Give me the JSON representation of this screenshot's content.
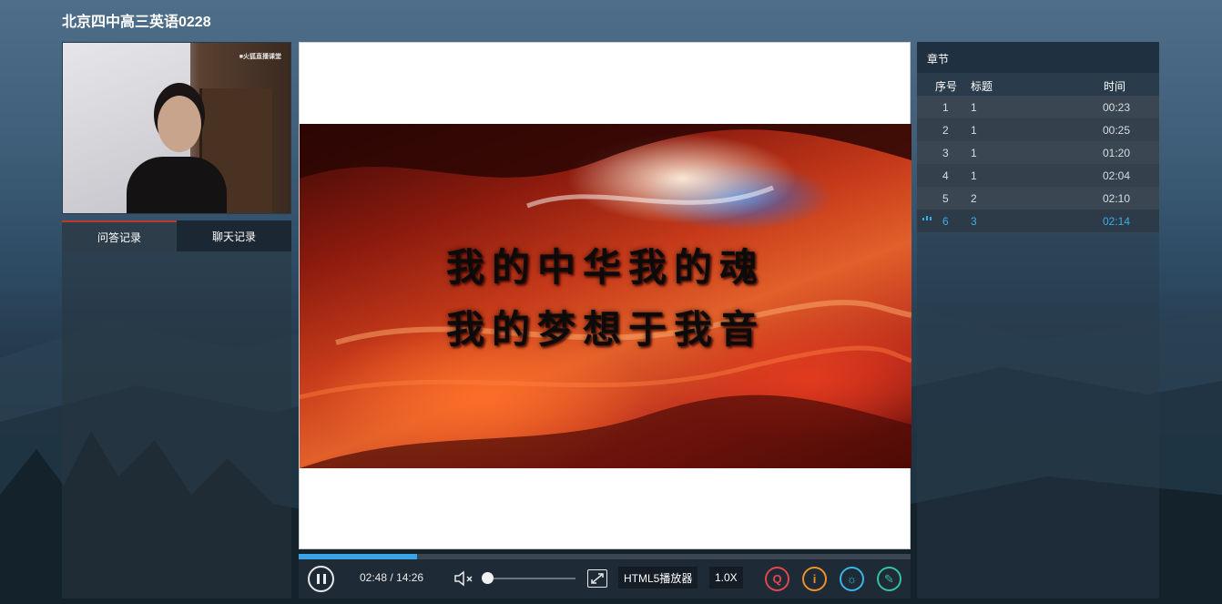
{
  "page": {
    "title": "北京四中高三英语0228"
  },
  "camera": {
    "watermark": "■火狐直播课堂"
  },
  "left_tabs": [
    {
      "label": "问答记录",
      "active": true
    },
    {
      "label": "聊天记录",
      "active": false
    }
  ],
  "slide": {
    "line1": "我的中华我的魂",
    "line2": "我的梦想于我音"
  },
  "player": {
    "current_time": "02:48",
    "separator": "/",
    "duration": "14:26",
    "progress_fraction": 0.194,
    "volume_level": 0.0,
    "muted": true,
    "player_mode_label": "HTML5播放器",
    "speed_label": "1.0X",
    "icons": {
      "play_pause": "pause-icon",
      "mute": "speaker-muted-icon",
      "fullscreen": "expand-icon",
      "qa": "qa-icon",
      "info": "info-icon",
      "brightness": "sun-icon",
      "note": "pen-icon"
    },
    "accent_color": "#3aa3e6"
  },
  "chapters": {
    "header": "章节",
    "columns": {
      "num": "序号",
      "title": "标题",
      "time": "时间"
    },
    "rows": [
      {
        "num": "1",
        "title": "1",
        "time": "00:23"
      },
      {
        "num": "2",
        "title": "1",
        "time": "00:25"
      },
      {
        "num": "3",
        "title": "1",
        "time": "01:20"
      },
      {
        "num": "4",
        "title": "1",
        "time": "02:04"
      },
      {
        "num": "5",
        "title": "2",
        "time": "02:10"
      },
      {
        "num": "6",
        "title": "3",
        "time": "02:14"
      }
    ],
    "current_index": 5,
    "current_color": "#3aaee8"
  }
}
